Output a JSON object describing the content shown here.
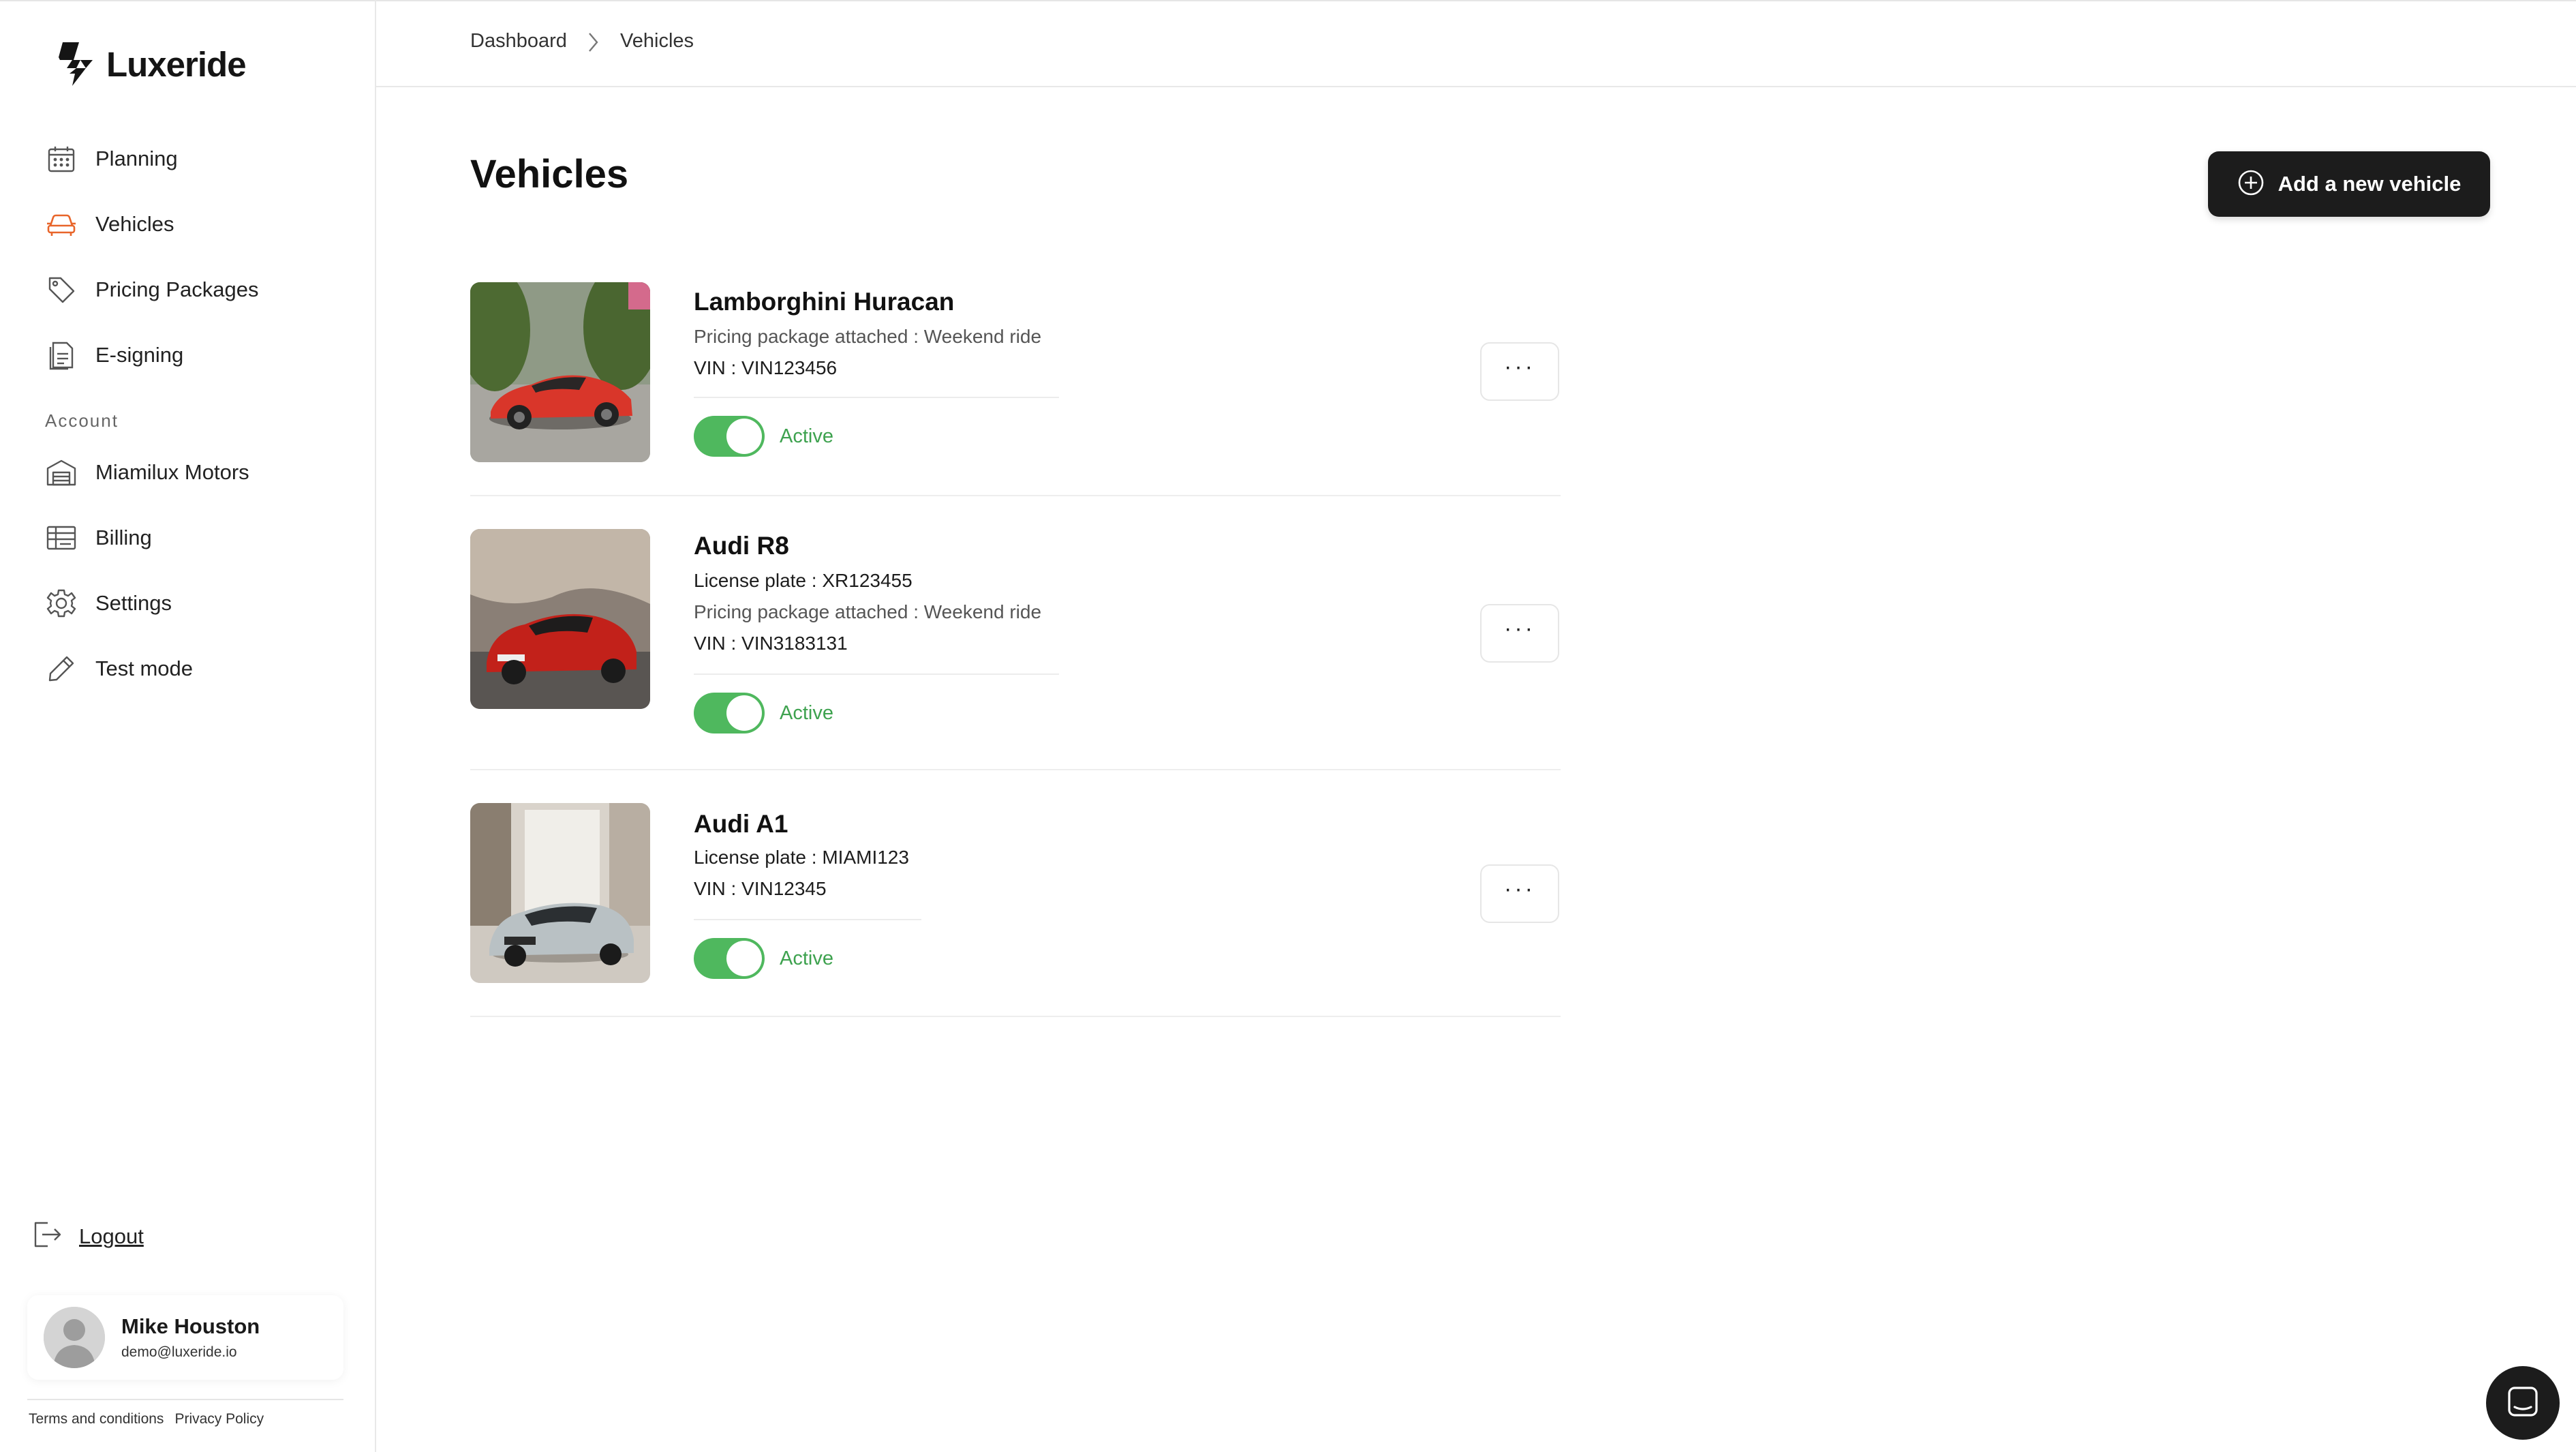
{
  "brand": {
    "name": "Luxeride"
  },
  "sidebar": {
    "items": [
      {
        "label": "Planning",
        "icon": "calendar-icon"
      },
      {
        "label": "Vehicles",
        "icon": "car-icon",
        "active": true
      },
      {
        "label": "Pricing Packages",
        "icon": "tag-icon"
      },
      {
        "label": "E-signing",
        "icon": "document-icon"
      }
    ],
    "account_title": "Account",
    "account_items": [
      {
        "label": "Miamilux Motors",
        "icon": "garage-icon"
      },
      {
        "label": "Billing",
        "icon": "billing-icon"
      },
      {
        "label": "Settings",
        "icon": "gear-icon"
      },
      {
        "label": "Test mode",
        "icon": "pencil-icon"
      }
    ],
    "logout_label": "Logout",
    "user": {
      "name": "Mike Houston",
      "email": "demo@luxeride.io"
    },
    "footer": {
      "terms": "Terms and conditions",
      "privacy": "Privacy Policy"
    }
  },
  "breadcrumb": {
    "items": [
      "Dashboard",
      "Vehicles"
    ]
  },
  "main": {
    "title": "Vehicles",
    "add_button_label": "Add a new vehicle"
  },
  "vehicles": [
    {
      "name": "Lamborghini Huracan",
      "lines": [
        "Pricing package attached : Weekend ride",
        "VIN : VIN123456"
      ],
      "status": "Active",
      "active": true
    },
    {
      "name": "Audi R8",
      "lines": [
        "License plate : XR123455",
        "Pricing package attached : Weekend ride",
        "VIN : VIN3183131"
      ],
      "status": "Active",
      "active": true
    },
    {
      "name": "Audi A1",
      "lines": [
        "License plate : MIAMI123",
        "VIN : VIN12345"
      ],
      "status": "Active",
      "active": true
    }
  ],
  "more_label": "···",
  "colors": {
    "accent": "#e8652a",
    "toggle_on": "#4fb85e",
    "status_text": "#3ea24f",
    "button_dark": "#1c1c1c"
  }
}
